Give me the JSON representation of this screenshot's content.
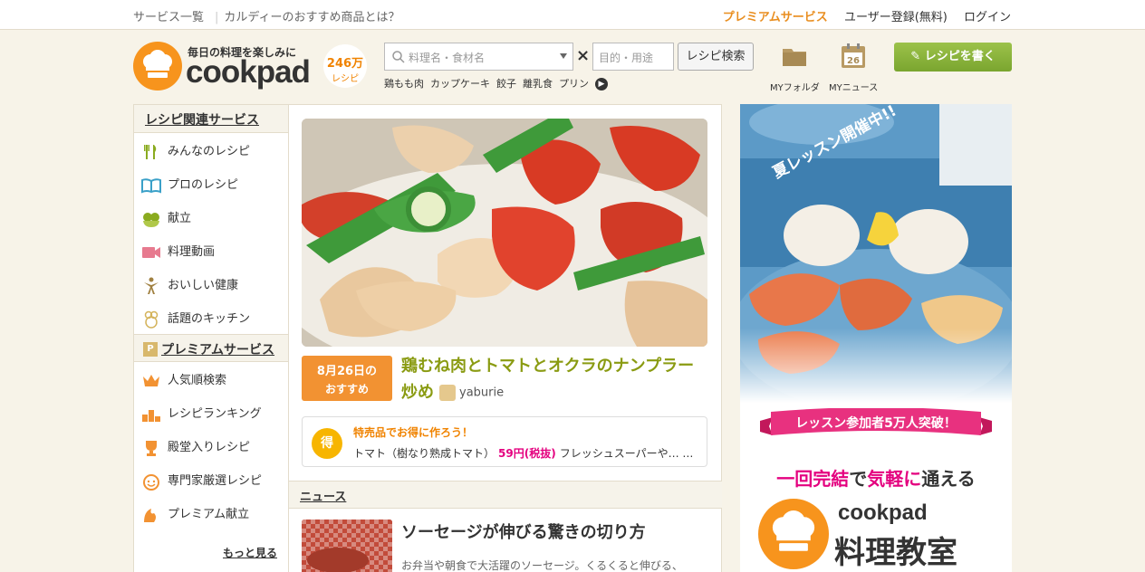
{
  "topbar": {
    "links_left": [
      "サービス一覧",
      "カルディーのおすすめ商品とは？"
    ],
    "premium": "プレミアムサービス",
    "register": "ユーザー登録(無料)",
    "login": "ログイン"
  },
  "header": {
    "tagline": "毎日の料理を楽しみに",
    "wordmark": "cookpad",
    "recipe_count": "246万",
    "recipe_unit": "レシピ",
    "search_placeholder": "料理名・食材名",
    "purpose_placeholder": "目的・用途",
    "search_button": "レシピ検索",
    "keywords": [
      "鶏もも肉",
      "カップケーキ",
      "餃子",
      "離乳食",
      "プリン"
    ],
    "my_folder": "MYフォルダ",
    "my_news": "MYニュース",
    "calendar_day": "26",
    "write_button": "レシピを書く",
    "accent": "#f7941d"
  },
  "sidebar": {
    "section1": "レシピ関連サービス",
    "items1": [
      "みんなのレシピ",
      "プロのレシピ",
      "献立",
      "料理動画",
      "おいしい健康",
      "話題のキッチン"
    ],
    "section2_mark": "P",
    "section2": "プレミアムサービス",
    "items2": [
      "人気順検索",
      "レシピランキング",
      "殿堂入りレシピ",
      "専門家厳選レシピ",
      "プレミアム献立"
    ],
    "more": "もっと見る"
  },
  "featured": {
    "date": "8月26日の",
    "date_sub": "おすすめ",
    "title": "鶏むね肉とトマトとオクラのナンプラー炒め",
    "author": "yaburie"
  },
  "sale": {
    "badge": "得",
    "headline": "特売品でお得に作ろう！",
    "item": "トマト（樹なり熟成トマト）",
    "price": "59円(税抜)",
    "store": "フレッシュスーパーや… …"
  },
  "news": {
    "section": "ニュース",
    "title": "ソーセージが伸びる驚きの切り方",
    "desc": "お弁当や朝食で大活躍のソーセージ。くるくると伸びる、"
  },
  "ad": {
    "lesson": "夏レッスン開催中!!",
    "banner": "レッスン参加者5万人突破！",
    "copy_a": "一回完結",
    "copy_b": "で",
    "copy_c": "気軽に",
    "copy_d": "通える",
    "brand": "cookpad",
    "brand2": "料理教室"
  }
}
